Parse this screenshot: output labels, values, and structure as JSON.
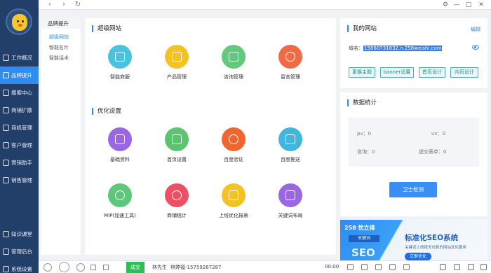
{
  "sidebar": {
    "items": [
      {
        "label": "工作概况",
        "icon": "monitor-icon",
        "active": false
      },
      {
        "label": "品牌提升",
        "icon": "chart-icon",
        "active": true
      },
      {
        "label": "搜索中心",
        "icon": "search-icon",
        "active": false
      },
      {
        "label": "商铺扩散",
        "icon": "shop-icon",
        "active": false
      },
      {
        "label": "商机管理",
        "icon": "briefcase-icon",
        "active": false
      },
      {
        "label": "客户管理",
        "icon": "user-icon",
        "active": false
      },
      {
        "label": "营销助手",
        "icon": "megaphone-icon",
        "active": false
      },
      {
        "label": "销售管理",
        "icon": "sales-icon",
        "active": false
      }
    ],
    "bottom_items": [
      {
        "label": "知识课堂",
        "icon": "book-icon"
      },
      {
        "label": "管理后台",
        "icon": "admin-icon"
      },
      {
        "label": "系统设置",
        "icon": "gear-icon"
      }
    ]
  },
  "subnav": {
    "title": "品牌提升",
    "items": [
      {
        "label": "超级网站",
        "active": true
      },
      {
        "label": "智能名片",
        "active": false
      },
      {
        "label": "智能话术",
        "active": false
      }
    ]
  },
  "main": {
    "section1_title": "超级网站",
    "section1_tiles": [
      {
        "label": "智能商服",
        "color": "#49c3df",
        "icon": "monitor-icon"
      },
      {
        "label": "产品管理",
        "color": "#f3c323",
        "icon": "box-icon"
      },
      {
        "label": "咨询管理",
        "color": "#62c97c",
        "icon": "chat-icon"
      },
      {
        "label": "留言管理",
        "color": "#f16a43",
        "icon": "message-icon"
      }
    ],
    "section2_title": "优化设置",
    "section2_tiles": [
      {
        "label": "基础资料",
        "color": "#9a66e3",
        "icon": "document-icon"
      },
      {
        "label": "首页设置",
        "color": "#5bc46f",
        "icon": "home-icon"
      },
      {
        "label": "百度验证",
        "color": "#f2652f",
        "icon": "gear-icon"
      },
      {
        "label": "百度推送",
        "color": "#40b6e0",
        "icon": "push-icon"
      },
      {
        "label": "MIP(加速工具)",
        "color": "#5dc87a",
        "icon": "mip-icon"
      },
      {
        "label": "商铺统计",
        "color": "#ef4f63",
        "icon": "stats-icon"
      },
      {
        "label": "上线优化报表",
        "color": "#f3c323",
        "icon": "report-icon"
      },
      {
        "label": "关键词布局",
        "color": "#9a66e3",
        "icon": "keyword-icon"
      }
    ]
  },
  "my_site": {
    "title": "我的网站",
    "edit_label": "编辑",
    "domain_label": "域名：",
    "domain_value": "15860731832.n.258weishi.com",
    "buttons": [
      "更换主题",
      "banner设置",
      "首页设计",
      "内页设计"
    ]
  },
  "stats": {
    "title": "数据统计",
    "pv": "pv：0",
    "uv": "uv：0",
    "consult": "咨询：0",
    "submit": "提交表单：0",
    "check_button": "卫士检测"
  },
  "ad": {
    "brand": "258 优立得",
    "sub": "关键词",
    "big": "SEO",
    "title": "标准化SEO系统",
    "desc": "关键词上线按天付款的网站优化服务",
    "button": "立即优化"
  },
  "bottom_bar": {
    "green_button": "成交",
    "contact_name": "林先生",
    "contact_phone": "林婷福-15759267287",
    "time": "00:00"
  },
  "colors": {
    "sidebar_bg": "#213f68",
    "accent": "#2f8cf0"
  }
}
